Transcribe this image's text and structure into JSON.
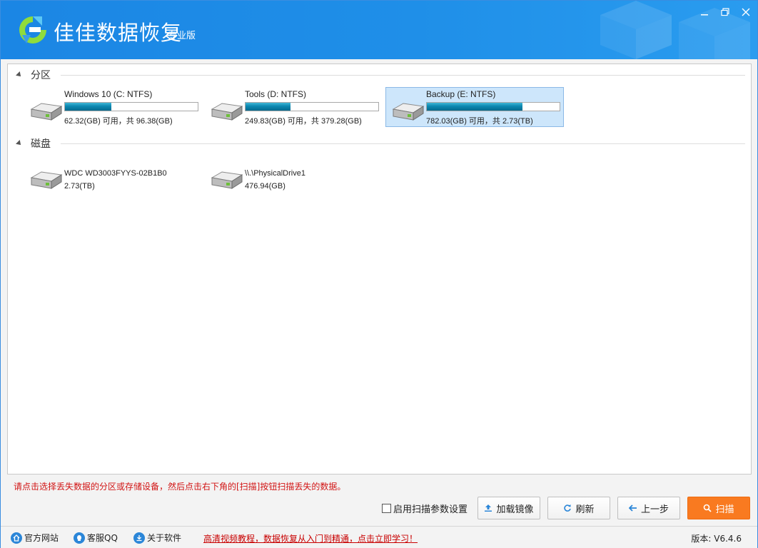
{
  "window": {
    "app_title": "佳佳数据恢复",
    "edition": "专业版",
    "accent_color": "#1f8fe8",
    "primary_button_color": "#f97a20"
  },
  "sections": {
    "partitions_label": "分区",
    "disks_label": "磁盘"
  },
  "partitions": [
    {
      "name": "Windows 10 (C: NTFS)",
      "capacity": "62.32(GB) 可用，共 96.38(GB)",
      "used_fraction": 0.35,
      "selected": false
    },
    {
      "name": "Tools (D: NTFS)",
      "capacity": "249.83(GB) 可用，共 379.28(GB)",
      "used_fraction": 0.34,
      "selected": false
    },
    {
      "name": "Backup (E: NTFS)",
      "capacity": "782.03(GB) 可用，共 2.73(TB)",
      "used_fraction": 0.72,
      "selected": true
    }
  ],
  "disks": [
    {
      "name": "WDC WD3003FYYS-02B1B0",
      "capacity": "2.73(TB)"
    },
    {
      "name": "\\\\.\\PhysicalDrive1",
      "capacity": "476.94(GB)"
    }
  ],
  "hint": "请点击选择丢失数据的分区或存储设备，然后点击右下角的[扫描]按钮扫描丢失的数据。",
  "controls": {
    "scan_params_label": "启用扫描参数设置",
    "scan_params_checked": false,
    "load_image_label": "加载镜像",
    "refresh_label": "刷新",
    "back_label": "上一步",
    "scan_label": "扫描"
  },
  "footer": {
    "website_label": "官方网站",
    "qq_label": "客服QQ",
    "about_label": "关于软件",
    "promo_text": "高清视频教程，数据恢复从入门到精通，点击立即学习！",
    "version_text": "版本: V6.4.6"
  }
}
